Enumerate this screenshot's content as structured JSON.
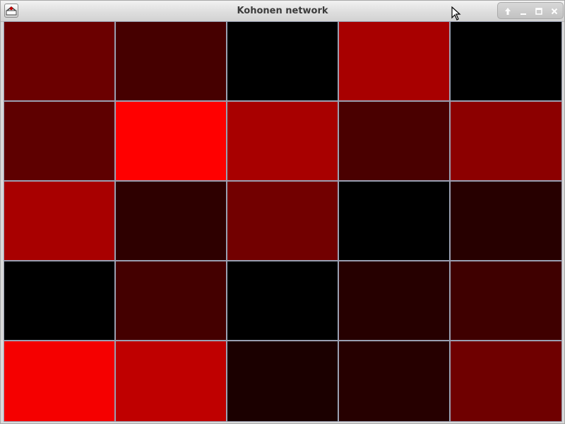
{
  "window": {
    "title": "Kohonen network",
    "app_icon": "java-app-icon",
    "controls": [
      {
        "name": "shade-button",
        "icon": "arrow-up-icon",
        "glyph": "⏶"
      },
      {
        "name": "minimize-button",
        "icon": "minimize-icon",
        "glyph": "‒"
      },
      {
        "name": "maximize-button",
        "icon": "maximize-icon",
        "glyph": "▫"
      },
      {
        "name": "close-button",
        "icon": "close-icon",
        "glyph": "✕"
      }
    ]
  },
  "grid": {
    "rows": 5,
    "cols": 5,
    "cells": [
      [
        "#6b0000",
        "#460000",
        "#000000",
        "#a80000",
        "#000000"
      ],
      [
        "#5e0000",
        "#ff0000",
        "#a80000",
        "#4a0000",
        "#8c0000"
      ],
      [
        "#a80000",
        "#2e0000",
        "#720000",
        "#000000",
        "#270000"
      ],
      [
        "#000000",
        "#440000",
        "#000000",
        "#260000",
        "#3f0000"
      ],
      [
        "#f50000",
        "#bf0000",
        "#1b0000",
        "#260000",
        "#6f0000"
      ]
    ]
  }
}
